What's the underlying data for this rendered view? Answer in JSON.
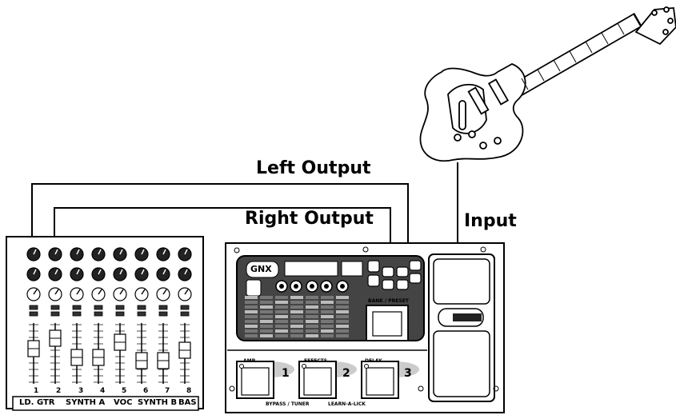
{
  "labels": {
    "left_output": "Left Output",
    "right_output": "Right Output",
    "input": "Input"
  },
  "mixer": {
    "channel_numbers": [
      "1",
      "2",
      "3",
      "4",
      "5",
      "6",
      "7",
      "8"
    ],
    "strip_labels": [
      "LD. GTR",
      "SYNTH A",
      "VOC",
      "SYNTH B",
      "BAS"
    ]
  },
  "processor": {
    "logo": "GNX",
    "bank_preset": "BANK / PRESET",
    "footswitches": [
      {
        "title": "AMP",
        "num": "1"
      },
      {
        "title": "EFFECTS",
        "num": "2"
      },
      {
        "title": "DELAY",
        "num": "3"
      }
    ],
    "bypass_tuner": "BYPASS / TUNER",
    "learn_a_lick": "LEARN-A-LICK"
  }
}
